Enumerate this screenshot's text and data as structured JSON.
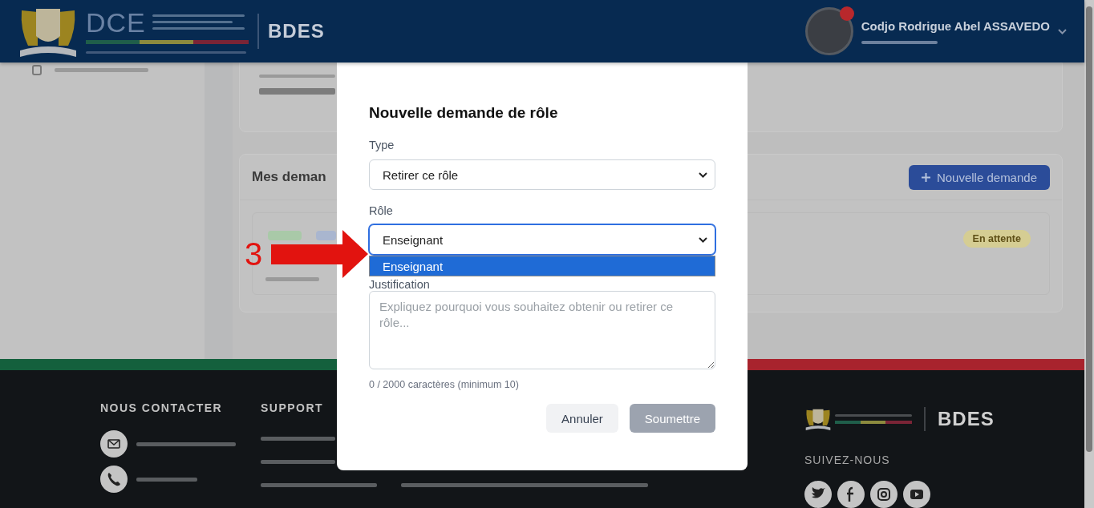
{
  "header": {
    "logo_text": "DCE",
    "app_name": "BDES",
    "user_name": "Codjo Rodrigue Abel ASSAVEDO"
  },
  "requests": {
    "title": "Mes deman",
    "new_button": "Nouvelle demande",
    "rows": [
      {
        "status": "En attente"
      }
    ]
  },
  "footer": {
    "contact_title": "NOUS CONTACTER",
    "support_title": "SUPPORT",
    "app_name": "BDES",
    "follow_title": "SUIVEZ-NOUS"
  },
  "modal": {
    "title": "Nouvelle demande de rôle",
    "fields": [
      {
        "kind": "select",
        "label": "Type",
        "value": "Retirer ce rôle",
        "focused": false,
        "expanded": false
      },
      {
        "kind": "select",
        "label": "Rôle",
        "value": "Enseignant",
        "focused": true,
        "expanded": true,
        "options": [
          {
            "label": "Enseignant",
            "selected": true
          }
        ]
      },
      {
        "kind": "textarea",
        "label": "Justification",
        "placeholder": "Expliquez pourquoi vous souhaitez obtenir ou retirer ce rôle..."
      }
    ],
    "counter": "0 / 2000 caractères (minimum 10)",
    "buttons": [
      {
        "label": "Annuler",
        "kind": "secondary",
        "disabled": false
      },
      {
        "label": "Soumettre",
        "kind": "primary",
        "disabled": true
      }
    ]
  },
  "annotation": {
    "label": "3"
  }
}
